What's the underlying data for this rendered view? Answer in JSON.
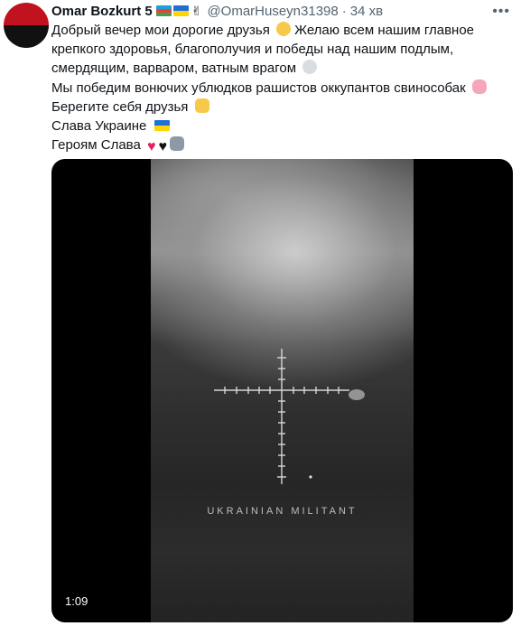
{
  "tweet": {
    "author": {
      "name": "Omar Bozkurt 5",
      "flag_1": "azerbaijan-flag-icon",
      "flag_2": "ukraine-flag-icon",
      "emoji": "victory-hand-icon",
      "handle": "@OmarHuseyn31398",
      "separator": "·",
      "time": "34 хв"
    },
    "more_icon": "ellipsis-icon",
    "lines": [
      {
        "text": "Добрый вечер мои дорогие друзья",
        "emoji": "clapping-hands-icon",
        "cont": " Желаю всем нашим главное"
      },
      {
        "text": "крепкого здоровья, благополучия и победы над нашим подлым,"
      },
      {
        "text": "смердящим, варваром, ватным врагом",
        "emoji": "skull-crossbones-icon"
      },
      {
        "text": "Мы победим вонючих ублюдков рашистов оккупантов свиноcобак",
        "emoji": "pig-nose-icon"
      },
      {
        "text": "Берегите себя друзья",
        "emoji": "victory-hand-icon"
      },
      {
        "text": "Слава Украине",
        "emoji": "ukraine-flag-icon"
      },
      {
        "text": "Героям Слава",
        "emoji": "heart-red-icon heart-black-icon wolf-icon"
      }
    ],
    "video": {
      "watermark": "UKRAINIAN   MILITANT",
      "duration": "1:09"
    }
  },
  "colors": {
    "text": "#0f1419",
    "muted": "#536471",
    "video_bg": "#000000"
  }
}
